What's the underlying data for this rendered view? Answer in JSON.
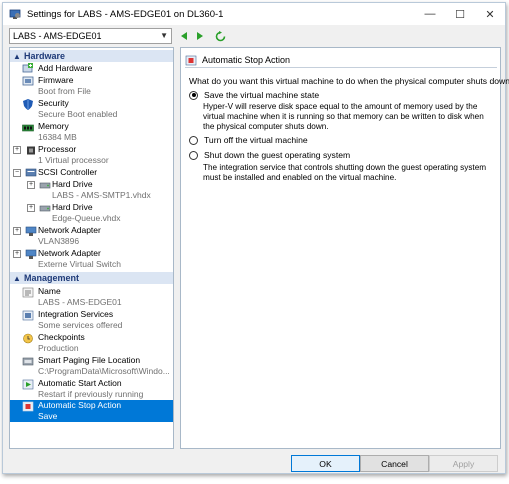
{
  "window": {
    "title": "Settings for LABS - AMS-EDGE01 on DL360-1",
    "minimize": "—",
    "maximize": "☐",
    "close": "✕"
  },
  "vm_selector": {
    "value": "LABS - AMS-EDGE01"
  },
  "sidebar": {
    "hardware_header": "Hardware",
    "management_header": "Management",
    "hardware_items": [
      {
        "label": "Add Hardware",
        "sub": ""
      },
      {
        "label": "Firmware",
        "sub": "Boot from File"
      },
      {
        "label": "Security",
        "sub": "Secure Boot enabled"
      },
      {
        "label": "Memory",
        "sub": "16384 MB"
      },
      {
        "label": "Processor",
        "sub": "1 Virtual processor"
      },
      {
        "label": "SCSI Controller",
        "sub": ""
      },
      {
        "label": "Hard Drive",
        "sub": "LABS - AMS-SMTP1.vhdx"
      },
      {
        "label": "Hard Drive",
        "sub": "Edge-Queue.vhdx"
      },
      {
        "label": "Network Adapter",
        "sub": "VLAN3896"
      },
      {
        "label": "Network Adapter",
        "sub": "Externe Virtual Switch"
      }
    ],
    "management_items": [
      {
        "label": "Name",
        "sub": "LABS - AMS-EDGE01"
      },
      {
        "label": "Integration Services",
        "sub": "Some services offered"
      },
      {
        "label": "Checkpoints",
        "sub": "Production"
      },
      {
        "label": "Smart Paging File Location",
        "sub": "C:\\ProgramData\\Microsoft\\Windo..."
      },
      {
        "label": "Automatic Start Action",
        "sub": "Restart if previously running"
      },
      {
        "label": "Automatic Stop Action",
        "sub": "Save"
      }
    ]
  },
  "main": {
    "section_title": "Automatic Stop Action",
    "question": "What do you want this virtual machine to do when the physical computer shuts down?",
    "options": [
      {
        "label": "Save the virtual machine state",
        "checked": true,
        "description": "Hyper-V will reserve disk space equal to the amount of memory used by the virtual machine when it is running so that memory can be written to disk when the physical computer shuts down."
      },
      {
        "label": "Turn off the virtual machine",
        "checked": false,
        "description": ""
      },
      {
        "label": "Shut down the guest operating system",
        "checked": false,
        "description": "The integration service that controls shutting down the guest operating system must be installed and enabled on the virtual machine."
      }
    ]
  },
  "footer": {
    "ok": "OK",
    "cancel": "Cancel",
    "apply": "Apply"
  },
  "colors": {
    "selection": "#0078d7",
    "section_header_bg": "#dbe5f3",
    "section_header_text": "#1e3a78",
    "nav_arrow": "#2aa02a"
  }
}
